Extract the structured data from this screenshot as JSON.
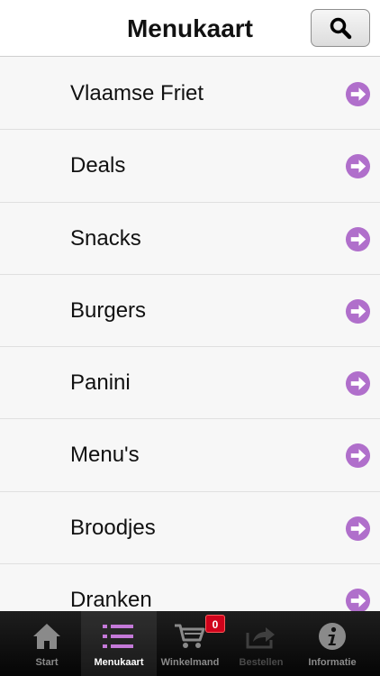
{
  "header": {
    "title": "Menukaart",
    "search_icon": "search-icon"
  },
  "menu": {
    "items": [
      {
        "label": "Vlaamse Friet"
      },
      {
        "label": "Deals"
      },
      {
        "label": "Snacks"
      },
      {
        "label": "Burgers"
      },
      {
        "label": "Panini"
      },
      {
        "label": "Menu's"
      },
      {
        "label": "Broodjes"
      },
      {
        "label": "Dranken"
      }
    ],
    "arrow_icon": "arrow-right-circle-icon",
    "accent_color": "#b06fcb"
  },
  "tabbar": {
    "tabs": [
      {
        "label": "Start",
        "icon": "home-icon"
      },
      {
        "label": "Menukaart",
        "icon": "list-icon"
      },
      {
        "label": "Winkelmand",
        "icon": "cart-icon"
      },
      {
        "label": "Bestellen",
        "icon": "share-icon"
      },
      {
        "label": "Informatie",
        "icon": "info-icon"
      }
    ],
    "active_tab": "Menukaart",
    "cart_count": "0",
    "badge_color": "#d0021b"
  }
}
